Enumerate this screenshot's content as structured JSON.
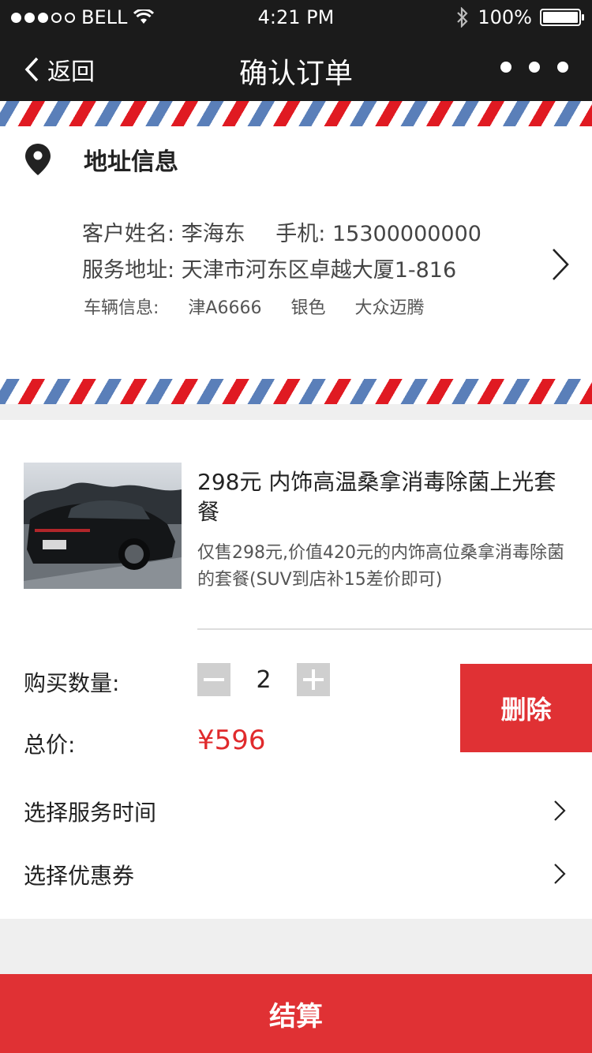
{
  "status_bar": {
    "carrier": "BELL",
    "time": "4:21 PM",
    "battery": "100%"
  },
  "nav": {
    "back_label": "返回",
    "title": "确认订单"
  },
  "address": {
    "heading": "地址信息",
    "name_label": "客户姓名:",
    "name_value": "李海东",
    "phone_label": "手机:",
    "phone_value": "15300000000",
    "addr_label": "服务地址:",
    "addr_value": "天津市河东区卓越大厦1-816",
    "car_label": "车辆信息:",
    "car_plate": "津A6666",
    "car_color": "银色",
    "car_model": "大众迈腾"
  },
  "product": {
    "name": "298元 内饰高温桑拿消毒除菌上光套餐",
    "description": "仅售298元,价值420元的内饰高位桑拿消毒除菌的套餐(SUV到店补15差价即可)",
    "qty_label": "购买数量:",
    "quantity": "2",
    "total_label": "总价:",
    "total": "¥596",
    "delete_label": "删除"
  },
  "options": {
    "service_time": "选择服务时间",
    "coupon": "选择优惠券"
  },
  "checkout_label": "结算",
  "colors": {
    "accent_red": "#e03134",
    "price_red": "#e02a2c",
    "stripe_blue": "#5a7fb9",
    "nav_bg": "#1b1b1b"
  }
}
